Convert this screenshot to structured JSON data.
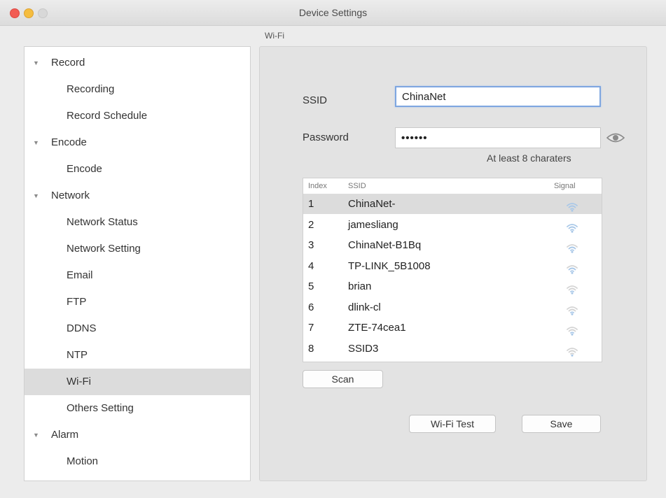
{
  "window": {
    "title": "Device Settings"
  },
  "sidebar": {
    "items": [
      {
        "label": "Record",
        "type": "group"
      },
      {
        "label": "Recording",
        "type": "child"
      },
      {
        "label": "Record Schedule",
        "type": "child"
      },
      {
        "label": "Encode",
        "type": "group"
      },
      {
        "label": "Encode",
        "type": "child"
      },
      {
        "label": "Network",
        "type": "group"
      },
      {
        "label": "Network Status",
        "type": "child"
      },
      {
        "label": "Network Setting",
        "type": "child"
      },
      {
        "label": "Email",
        "type": "child"
      },
      {
        "label": "FTP",
        "type": "child"
      },
      {
        "label": "DDNS",
        "type": "child"
      },
      {
        "label": "NTP",
        "type": "child"
      },
      {
        "label": "Wi-Fi",
        "type": "child",
        "selected": true
      },
      {
        "label": "Others Setting",
        "type": "child"
      },
      {
        "label": "Alarm",
        "type": "group"
      },
      {
        "label": "Motion",
        "type": "child"
      }
    ]
  },
  "panel": {
    "label": "Wi-Fi",
    "ssid_label": "SSID",
    "ssid_value": "ChinaNet",
    "password_label": "Password",
    "password_value": "••••••",
    "password_hint": "At least 8 charaters",
    "table": {
      "headers": {
        "index": "Index",
        "ssid": "SSID",
        "signal": "Signal"
      },
      "rows": [
        {
          "index": "1",
          "ssid": "ChinaNet-",
          "signal": 4,
          "selected": true
        },
        {
          "index": "2",
          "ssid": "jamesliang",
          "signal": 4
        },
        {
          "index": "3",
          "ssid": "ChinaNet-B1Bq",
          "signal": 3
        },
        {
          "index": "4",
          "ssid": "TP-LINK_5B1008",
          "signal": 3
        },
        {
          "index": "5",
          "ssid": "brian",
          "signal": 2
        },
        {
          "index": "6",
          "ssid": "dlink-cl",
          "signal": 2
        },
        {
          "index": "7",
          "ssid": "ZTE-74cea1",
          "signal": 2
        },
        {
          "index": "8",
          "ssid": "SSID3",
          "signal": 1
        }
      ]
    },
    "scan_label": "Scan",
    "wifi_test_label": "Wi-Fi Test",
    "save_label": "Save"
  },
  "colors": {
    "signal_active": "#a9c8e8",
    "signal_inactive": "#d4d4d4"
  }
}
